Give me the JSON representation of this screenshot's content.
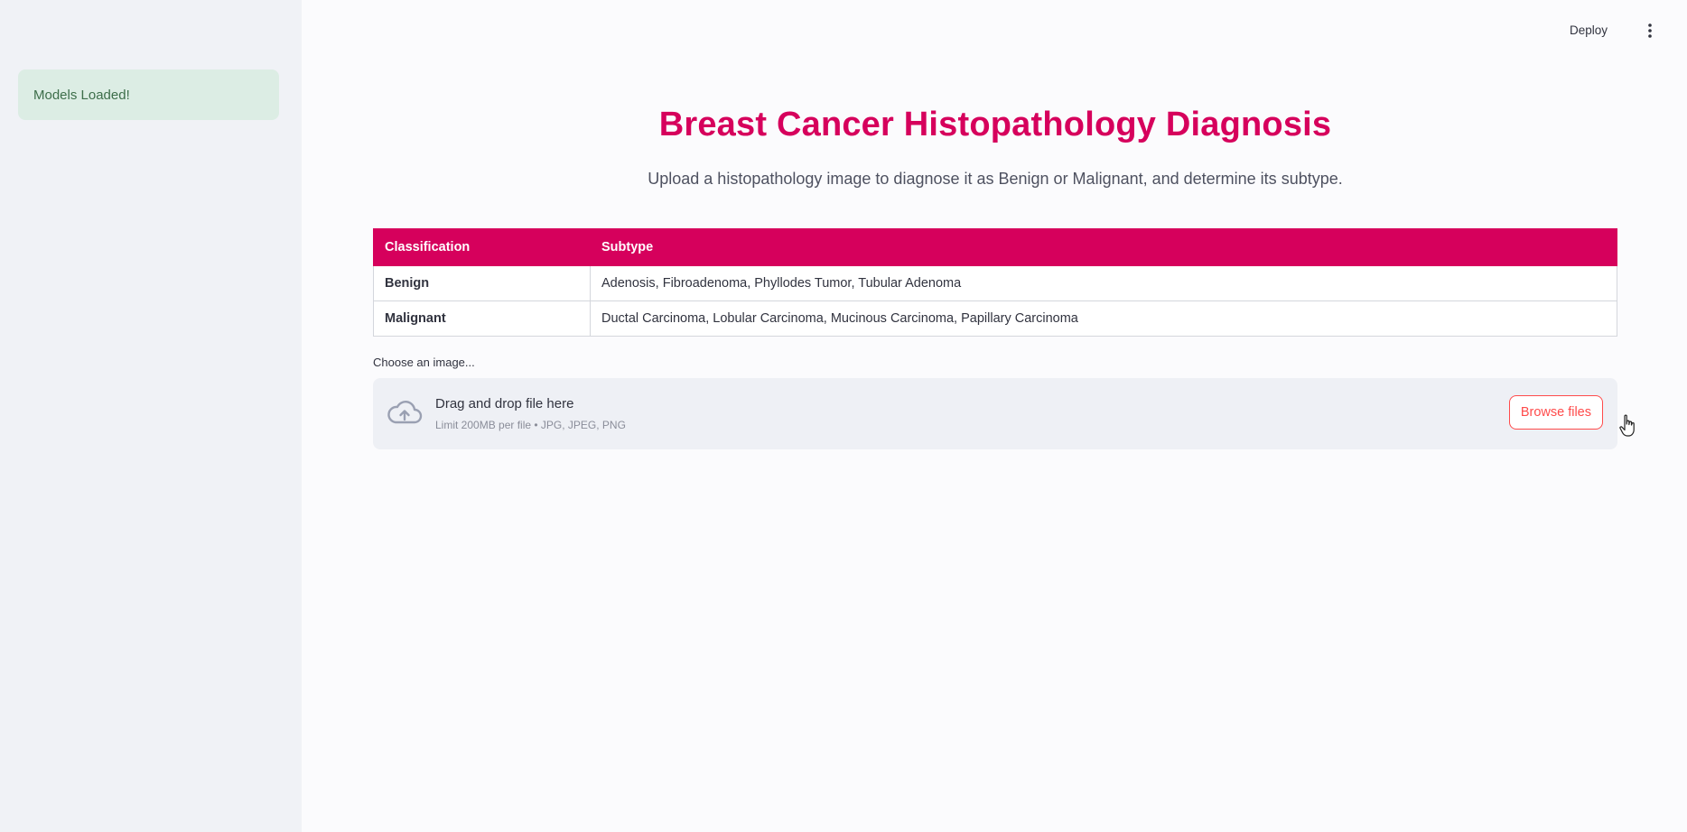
{
  "sidebar": {
    "status_message": "Models Loaded!"
  },
  "header": {
    "deploy_label": "Deploy",
    "menu_icon": "kebab-menu-icon"
  },
  "main": {
    "title": "Breast Cancer Histopathology Diagnosis",
    "subtitle": "Upload a histopathology image to diagnose it as Benign or Malignant, and determine its subtype.",
    "table": {
      "headers": [
        "Classification",
        "Subtype"
      ],
      "rows": [
        [
          "Benign",
          "Adenosis, Fibroadenoma, Phyllodes Tumor, Tubular Adenoma"
        ],
        [
          "Malignant",
          "Ductal Carcinoma, Lobular Carcinoma, Mucinous Carcinoma, Papillary Carcinoma"
        ]
      ]
    },
    "uploader": {
      "label": "Choose an image...",
      "drop_title": "Drag and drop file here",
      "drop_limits": "Limit 200MB per file • JPG, JPEG, PNG",
      "browse_label": "Browse files",
      "icon": "cloud-upload-icon"
    }
  },
  "colors": {
    "accent": "#d6005c",
    "button_accent": "#ff4b4b",
    "success_bg": "#dcede4",
    "success_text": "#3d6e4a"
  }
}
